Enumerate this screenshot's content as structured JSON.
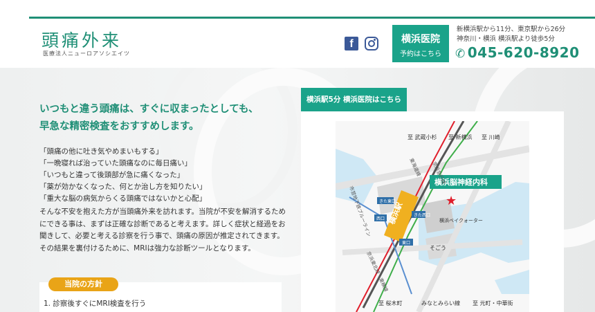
{
  "header": {
    "logo_title": "頭痛外来",
    "logo_subtitle": "医療法人ニューロアソシエイツ",
    "reserve_title": "横浜医院",
    "reserve_sub": "予約はこちら",
    "access_line1": "新横浜駅から11分、東京駅から26分",
    "access_line2": "神奈川・横浜 横浜駅より徒歩5分",
    "phone": "045-620-8920",
    "social_icons": [
      "facebook-icon",
      "instagram-icon"
    ]
  },
  "hero": {
    "headline_line1": "いつもと違う頭痛は、すぐに収まったとしても、",
    "headline_line2": "早急な精密検査をおすすめします。",
    "quotes": [
      "「頭痛の他に吐き気やめまいもする」",
      "「一晩寝れば治っていた頭痛なのに毎日痛い」",
      "「いつもと違って後頭部が急に痛くなった」",
      "「薬が効かなくなった、何とか治し方を知りたい」",
      "「重大な脳の病気からくる頭痛ではないかと心配」"
    ],
    "description": "そんな不安を抱えた方が当頭痛外来を訪れます。当院が不安を解消するためにできる事は、まずは正確な診断であると考えます。詳しく症状と経過をお聞きして、必要と考える診察を行う事で、頭痛の原因が推定されてきます。その結果を裏付けるために、MRIは強力な診断ツールとなります。"
  },
  "policy": {
    "tab_label": "当院の方針",
    "item1": "1. 診察後すぐにMRI検査を行う"
  },
  "map": {
    "tab_label": "横浜駅5分 横浜医院はこちら",
    "clinic_label": "横浜脳神経内科",
    "station_label": "横浜駅",
    "place_labels": {
      "top1": "至 武蔵小杉",
      "top2": "至 新横浜",
      "top3": "至 川崎",
      "bay": "横浜ベイクォーター",
      "sogo": "そごう",
      "bottom1": "至 桜木町",
      "bottom2": "みなとみらい線",
      "bottom3": "至 元町・中華街",
      "line_keikyu": "京浜急行線",
      "line_tokaido": "東海道線",
      "line_subway": "市営地下鉄ブルーライン",
      "line_keihin": "京浜東北線・東横線",
      "exit_kita": "きた東口",
      "exit_west": "西口",
      "exit_nishi": "きた西口",
      "exit_east": "東口"
    },
    "colors": {
      "accent": "#1aa38a",
      "station": "#f0b020",
      "clinic_star": "#e01e2b",
      "water": "#cfe8f5",
      "exit_box": "#2f6fa8"
    }
  }
}
